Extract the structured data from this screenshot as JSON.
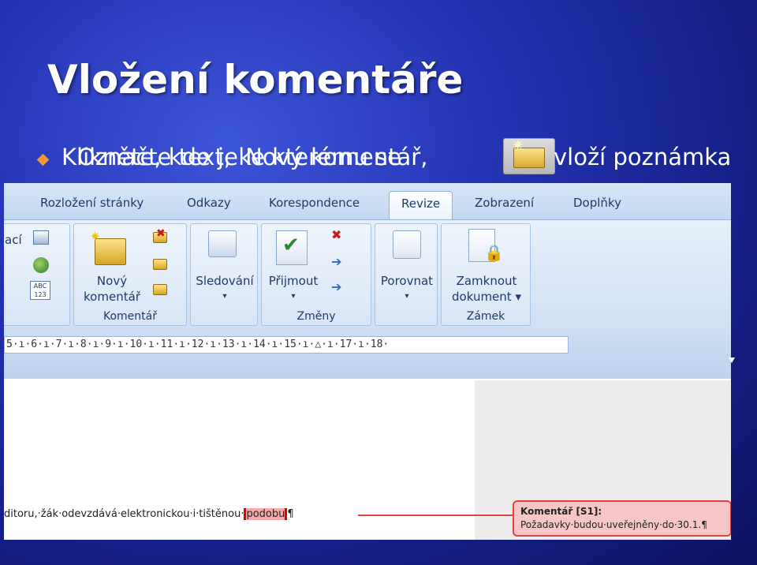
{
  "slide": {
    "title": "Vložení komentáře",
    "bullet_a": "Klikněte, kde je Nový komentář,",
    "bullet_b": "Označte text, ke kterému se",
    "bullet_c": "vloží poznámka"
  },
  "tabs": [
    "Rozložení stránky",
    "Odkazy",
    "Korespondence",
    "Revize",
    "Zobrazení",
    "Doplňky"
  ],
  "active_tab": "Revize",
  "ribbon": {
    "cut_label": "ací",
    "groups": {
      "komentar": {
        "label": "Komentář",
        "new_comment_line1": "Nový",
        "new_comment_line2": "komentář"
      },
      "sledovani": {
        "label": "Sledování",
        "arrow": "▾"
      },
      "zmeny": {
        "label": "Změny",
        "accept": "Přijmout",
        "arrow": "▾"
      },
      "porovnat": {
        "label": "Porovnat",
        "arrow": "▾"
      },
      "zamek": {
        "label": "Zámek",
        "lock_line1": "Zamknout",
        "lock_line2": "dokument ▾"
      }
    },
    "abc_label": "ABC 123"
  },
  "ruler": {
    "text": "5·ı·6·ı·7·ı·8·ı·9·ı·10·ı·11·ı·12·ı·13·ı·14·ı·15·ı·△·ı·17·ı·18·"
  },
  "document": {
    "text_before": "ditoru,·žák·odevzdává·elektronickou·i·tištěnou·",
    "text_highlight": "podobu",
    "text_after": "¶"
  },
  "comment": {
    "label": "Komentář [S1]:",
    "text": "Požadavky·budou·uveřejněny·do·30.1.¶"
  },
  "colors": {
    "bullet": "#f39a2a",
    "comment_border": "#dd4444",
    "comment_fill": "#f7c6c6",
    "ribbon_text": "#1d3a6a"
  }
}
